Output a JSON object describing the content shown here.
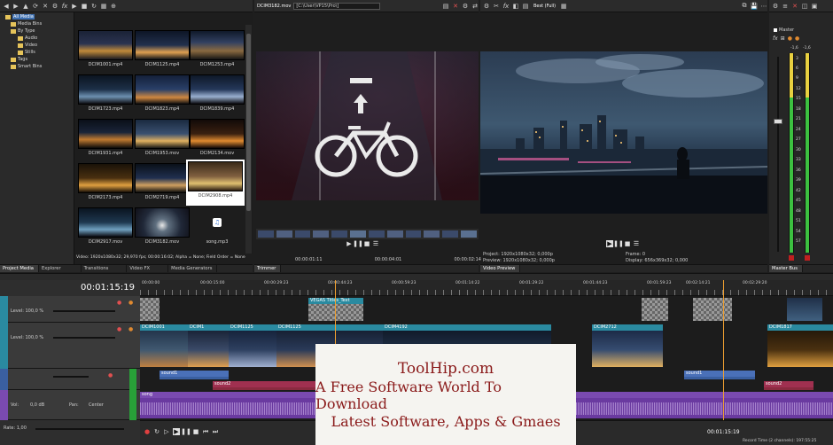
{
  "explorer": {
    "tree": [
      "All Media",
      "Media Bins",
      "By Type",
      "Audio",
      "Video",
      "Stills",
      "Tags",
      "Smart Bins"
    ],
    "items": [
      {
        "name": "DCIM1001.mp4"
      },
      {
        "name": "DCIM1125.mp4"
      },
      {
        "name": "DCIM1253.mp4"
      },
      {
        "name": "DCIM1723.mp4"
      },
      {
        "name": "DCIM1823.mp4"
      },
      {
        "name": "DCIM1839.mp4"
      },
      {
        "name": "DCIM1931.mp4"
      },
      {
        "name": "DCIM1953.mov"
      },
      {
        "name": "DCIM2134.mov"
      },
      {
        "name": "DCIM2173.mp4"
      },
      {
        "name": "DCIM2719.mp4"
      },
      {
        "name": "DCIM2908.mp4"
      },
      {
        "name": "DCIM2917.mov"
      },
      {
        "name": "DCIM3182.mov"
      },
      {
        "name": "song.mp3"
      }
    ],
    "info": "Video: 1920x1080x32; 29,970 fps; 00:00:16:02; Alpha = None; Field Order = None"
  },
  "tabs_left": [
    "Project Media",
    "Explorer",
    "Transitions",
    "Video FX",
    "Media Generators"
  ],
  "trimmer": {
    "file": "DCIM3182.mov",
    "path": "C:\\User\\VP15\\Pro\\",
    "time_in": "00:00:01:11",
    "time_len": "00:00:04:01",
    "time_out": "00:00:02:14",
    "tab": "Trimmer"
  },
  "preview": {
    "quality": "Best (Full)",
    "project_label": "Project:",
    "project": "1920x1080x32; 0,000p",
    "preview_label": "Preview:",
    "preview": "1920x1080x32; 0,000p",
    "frame_label": "Frame:",
    "frame": "0",
    "display_label": "Display:",
    "display": "656x369x32; 0,000",
    "tab": "Video Preview"
  },
  "master": {
    "title": "Master",
    "left_db": "-1,6",
    "right_db": "-1,6",
    "scale": [
      "3",
      "6",
      "9",
      "12",
      "15",
      "18",
      "21",
      "24",
      "27",
      "30",
      "33",
      "36",
      "39",
      "42",
      "45",
      "48",
      "51",
      "54",
      "57"
    ],
    "tab": "Master Bus"
  },
  "timeline": {
    "timecode": "00:01:15:19",
    "ruler": [
      "00:00:00",
      "00:00:15:00",
      "00:00:29:23",
      "00:00:44:23",
      "00:00:59:23",
      "00:01:14:22",
      "00:01:29:22",
      "00:01:44:23",
      "00:01:59:23",
      "00:02:14:21",
      "00:02:29:20"
    ],
    "tracks": [
      {
        "level": "Level: 100,0 %"
      },
      {
        "level": "Level: 100,0 %"
      }
    ],
    "audio_vol": "Vol:",
    "audio_db": "0,0 dB",
    "audio_pan": "Pan:",
    "audio_center": "Center",
    "rate": "Rate: 1,00",
    "clips": {
      "title": "VEGAS Titles_Text",
      "video": [
        "DCIM1001",
        "DCIM1",
        "DCIM1125",
        "DCIM1125",
        "DCIM4192",
        "DCIM2712",
        "DCIM1817"
      ],
      "sound1": "sound1",
      "sound2": "sound2",
      "song": "song",
      "song_end": "sound2"
    },
    "footer_time": "00:01:15:19",
    "footer_rec": "Record Time (2 channels): 197:55:25"
  },
  "watermark": {
    "line1": "ToolHip.com",
    "line2": "A Free Software World To Download",
    "line3": "Latest Software, Apps & Gmaes"
  }
}
